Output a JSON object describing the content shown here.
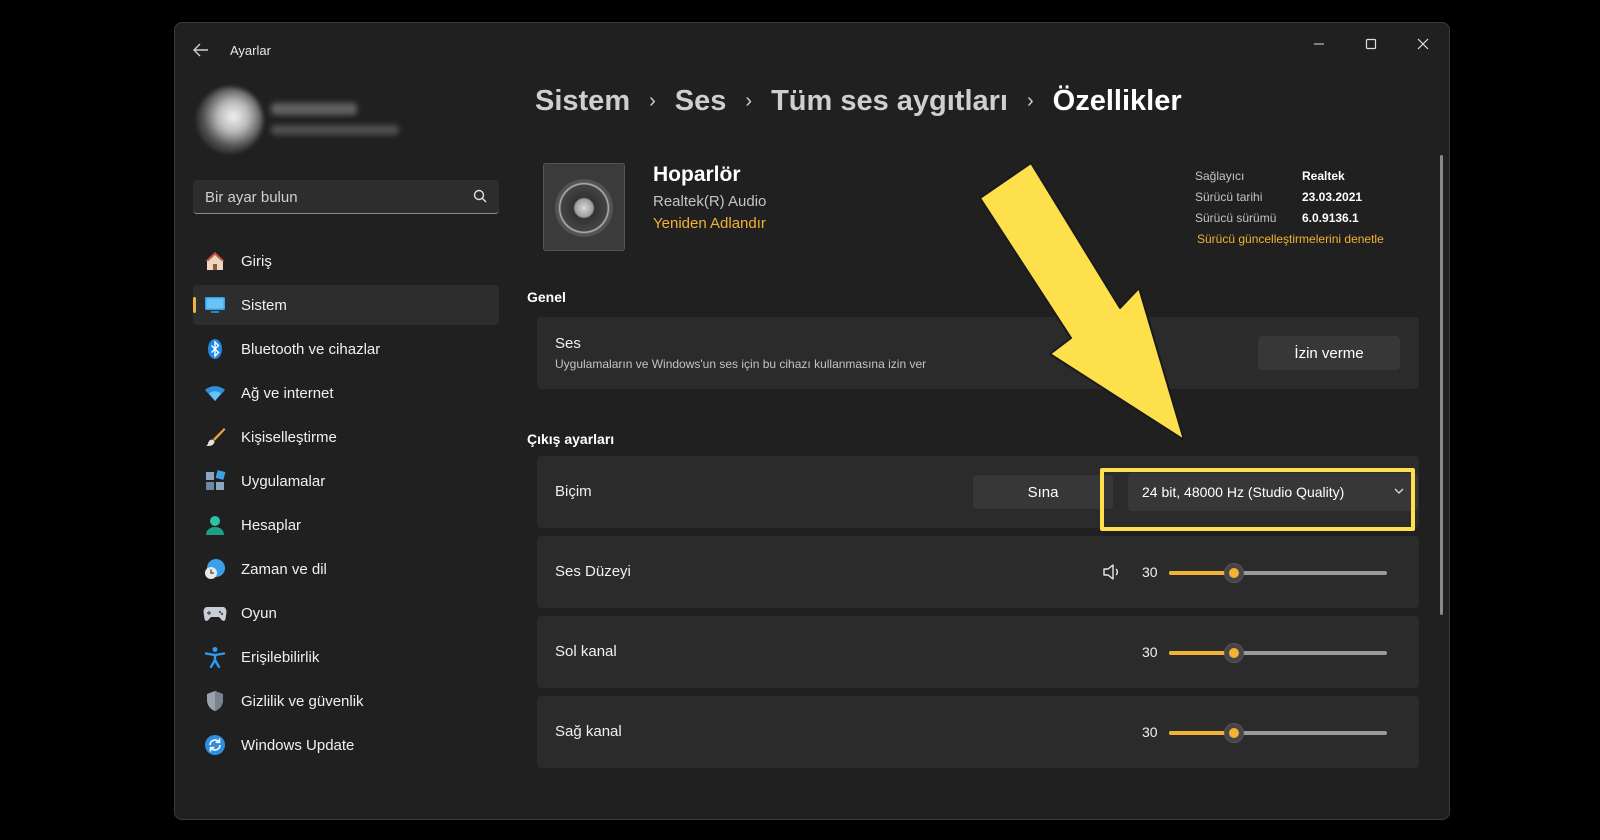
{
  "window": {
    "title": "Ayarlar"
  },
  "sidebar": {
    "search_placeholder": "Bir ayar bulun",
    "items": [
      {
        "label": "Giriş",
        "icon": "home-icon"
      },
      {
        "label": "Sistem",
        "icon": "display-icon",
        "selected": true
      },
      {
        "label": "Bluetooth ve cihazlar",
        "icon": "bluetooth-icon"
      },
      {
        "label": "Ağ ve internet",
        "icon": "wifi-icon"
      },
      {
        "label": "Kişiselleştirme",
        "icon": "brush-icon"
      },
      {
        "label": "Uygulamalar",
        "icon": "apps-icon"
      },
      {
        "label": "Hesaplar",
        "icon": "person-icon"
      },
      {
        "label": "Zaman ve dil",
        "icon": "clock-globe-icon"
      },
      {
        "label": "Oyun",
        "icon": "gamepad-icon"
      },
      {
        "label": "Erişilebilirlik",
        "icon": "accessibility-icon"
      },
      {
        "label": "Gizlilik ve güvenlik",
        "icon": "shield-icon"
      },
      {
        "label": "Windows Update",
        "icon": "update-icon"
      }
    ]
  },
  "breadcrumb": [
    "Sistem",
    "Ses",
    "Tüm ses aygıtları",
    "Özellikler"
  ],
  "device": {
    "name": "Hoparlör",
    "subtitle": "Realtek(R) Audio",
    "rename_link": "Yeniden Adlandır"
  },
  "driver_info": {
    "rows": [
      {
        "key": "Sağlayıcı",
        "value": "Realtek"
      },
      {
        "key": "Sürücü tarihi",
        "value": "23.03.2021"
      },
      {
        "key": "Sürücü sürümü",
        "value": "6.0.9136.1"
      }
    ],
    "update_link": "Sürücü güncelleştirmelerini denetle"
  },
  "general": {
    "section_title": "Genel",
    "audio": {
      "title": "Ses",
      "description": "Uygulamaların ve Windows'un ses için bu cihazı kullanmasına izin ver",
      "button": "İzin verme"
    }
  },
  "output": {
    "section_title": "Çıkış ayarları",
    "format": {
      "label": "Biçim",
      "test_button": "Sına",
      "selected": "24 bit, 48000 Hz (Studio Quality)"
    },
    "volume": {
      "label": "Ses Düzeyi",
      "value": "30",
      "level": 0.3
    },
    "left": {
      "label": "Sol kanal",
      "value": "30",
      "level": 0.3
    },
    "right": {
      "label": "Sağ kanal",
      "value": "30",
      "level": 0.3
    }
  },
  "colors": {
    "accent": "#f2b233",
    "highlight": "#fde04c",
    "background": "#202020",
    "card": "#2b2b2b"
  }
}
